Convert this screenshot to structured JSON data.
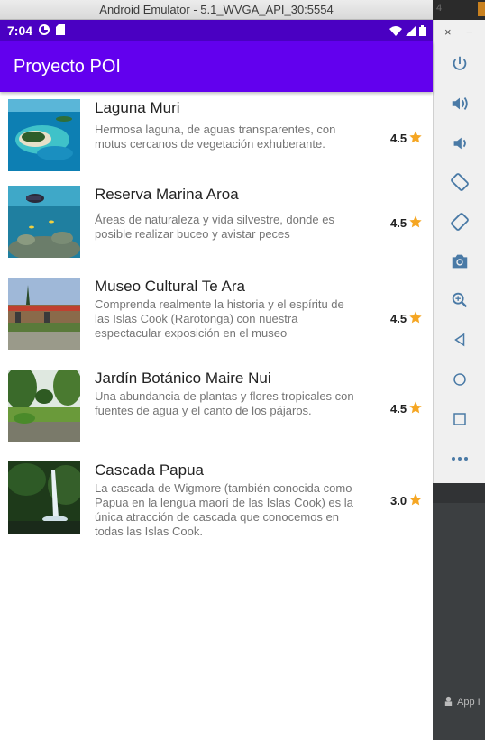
{
  "window": {
    "title": "Android Emulator - 5.1_WVGA_API_30:5554"
  },
  "ide": {
    "tab_number": "4",
    "bottom_tab_label": "App I"
  },
  "statusbar": {
    "time": "7:04"
  },
  "app": {
    "title": "Proyecto POI"
  },
  "places": [
    {
      "title": "Laguna Muri",
      "description": "Hermosa laguna, de aguas transparentes, con motus cercanos de vegetación exhuberante.",
      "rating": "4.5"
    },
    {
      "title": "Reserva Marina Aroa",
      "description": "Áreas de naturaleza y vida silvestre, donde es posible realizar buceo y avistar peces",
      "rating": "4.5"
    },
    {
      "title": "Museo Cultural Te Ara",
      "description": "Comprenda realmente la historia y el espíritu de las Islas Cook (Rarotonga) con nuestra espectacular exposición en el museo",
      "rating": "4.5"
    },
    {
      "title": "Jardín Botánico Maire Nui",
      "description": "Una abundancia de plantas y flores tropicales con fuentes de agua y el canto de los pájaros.",
      "rating": "4.5"
    },
    {
      "title": "Cascada Papua",
      "description": "La cascada de Wigmore (también conocida como Papua en la lengua maorí de las Islas Cook) es la única atracción de cascada que conocemos en todas las Islas Cook.",
      "rating": "3.0"
    }
  ],
  "emulator_controls": {
    "close": "×",
    "minimize": "−",
    "buttons": [
      "power-icon",
      "volume-up-icon",
      "volume-down-icon",
      "rotate-left-icon",
      "rotate-right-icon",
      "camera-icon",
      "zoom-icon",
      "back-icon",
      "home-icon",
      "overview-icon",
      "more-icon"
    ]
  },
  "colors": {
    "primary": "#6200ee",
    "primary_dark": "#4a00c2",
    "star": "#f5a623"
  }
}
